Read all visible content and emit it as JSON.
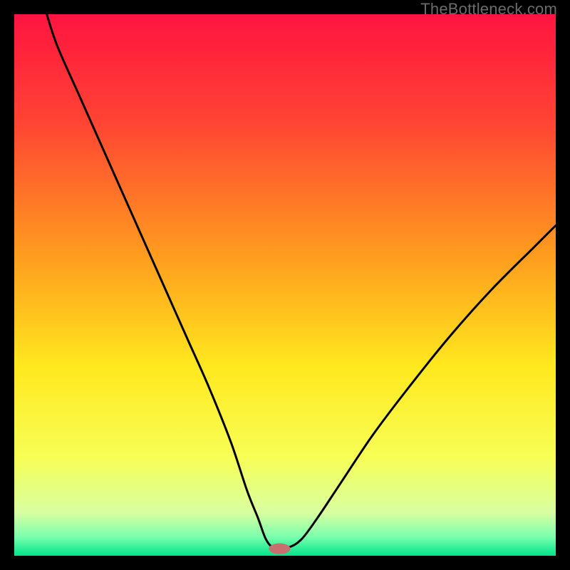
{
  "watermark": "TheBottleneck.com",
  "chart_data": {
    "type": "line",
    "title": "",
    "xlabel": "",
    "ylabel": "",
    "xlim": [
      0,
      100
    ],
    "ylim": [
      0,
      100
    ],
    "grid": false,
    "legend": false,
    "gradient_stops": [
      {
        "offset": 0.0,
        "color": "#ff1440"
      },
      {
        "offset": 0.2,
        "color": "#ff4433"
      },
      {
        "offset": 0.45,
        "color": "#ff9e1e"
      },
      {
        "offset": 0.65,
        "color": "#ffe81e"
      },
      {
        "offset": 0.82,
        "color": "#f7ff57"
      },
      {
        "offset": 0.92,
        "color": "#d8ffa0"
      },
      {
        "offset": 0.965,
        "color": "#7bffad"
      },
      {
        "offset": 1.0,
        "color": "#00e48b"
      }
    ],
    "series": [
      {
        "name": "bottleneck-curve",
        "x": [
          6,
          8,
          12,
          16,
          20,
          24,
          28,
          32,
          36,
          40,
          43,
          45,
          46.5,
          48,
          50.5,
          53,
          56,
          60,
          66,
          72,
          80,
          88,
          96,
          100
        ],
        "y": [
          100,
          94,
          85,
          76,
          67,
          58,
          49,
          40,
          31,
          21,
          12,
          7,
          3,
          1.5,
          1.5,
          3,
          7,
          13,
          22,
          30,
          40,
          49,
          57,
          61
        ]
      }
    ],
    "marker": {
      "x": 49,
      "y": 1.3,
      "rx": 2.0,
      "ry": 1.0,
      "color": "#c96f6f"
    }
  }
}
